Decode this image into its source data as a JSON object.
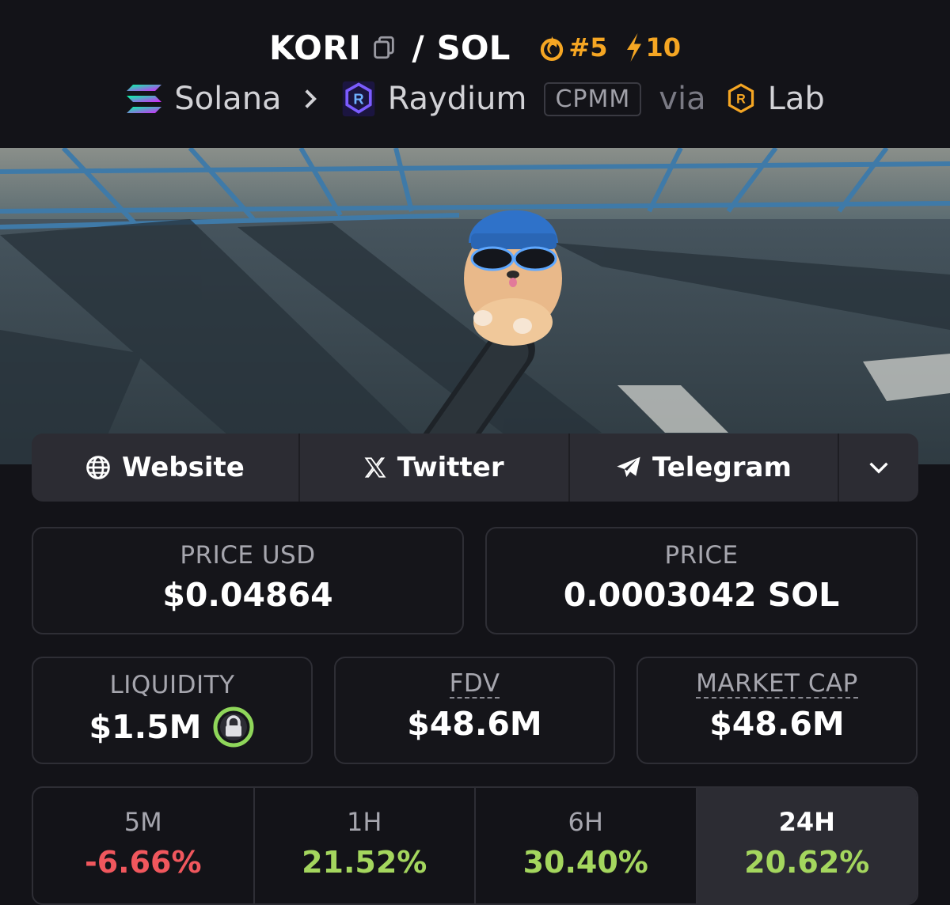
{
  "pair": {
    "base": "KORI",
    "separator": "/",
    "quote": "SOL"
  },
  "trending": {
    "rank": "#5",
    "boosts": "10"
  },
  "chain": {
    "name": "Solana",
    "dex": "Raydium",
    "pool_type": "CPMM",
    "via_label": "via",
    "launchpad": "Lab"
  },
  "links": {
    "website": "Website",
    "twitter": "Twitter",
    "telegram": "Telegram"
  },
  "stats": {
    "price_usd_label": "PRICE USD",
    "price_usd": "$0.04864",
    "price_label": "PRICE",
    "price_native": "0.0003042 SOL",
    "liquidity_label": "LIQUIDITY",
    "liquidity": "$1.5M",
    "fdv_label": "FDV",
    "fdv": "$48.6M",
    "mcap_label": "MARKET CAP",
    "mcap": "$48.6M"
  },
  "changes": [
    {
      "period": "5M",
      "value": "-6.66%",
      "color": "#f0575d"
    },
    {
      "period": "1H",
      "value": "21.52%",
      "color": "#a4d65e"
    },
    {
      "period": "6H",
      "value": "30.40%",
      "color": "#a4d65e"
    },
    {
      "period": "24H",
      "value": "20.62%",
      "color": "#a4d65e"
    }
  ],
  "icons": {
    "copy": "copy-icon",
    "flame": "flame-icon",
    "bolt": "bolt-icon",
    "chevron_right": "chevron-right-icon",
    "globe": "globe-icon",
    "x": "x-logo-icon",
    "telegram": "telegram-icon",
    "chevron_down": "chevron-down-icon",
    "lock": "lock-icon"
  }
}
